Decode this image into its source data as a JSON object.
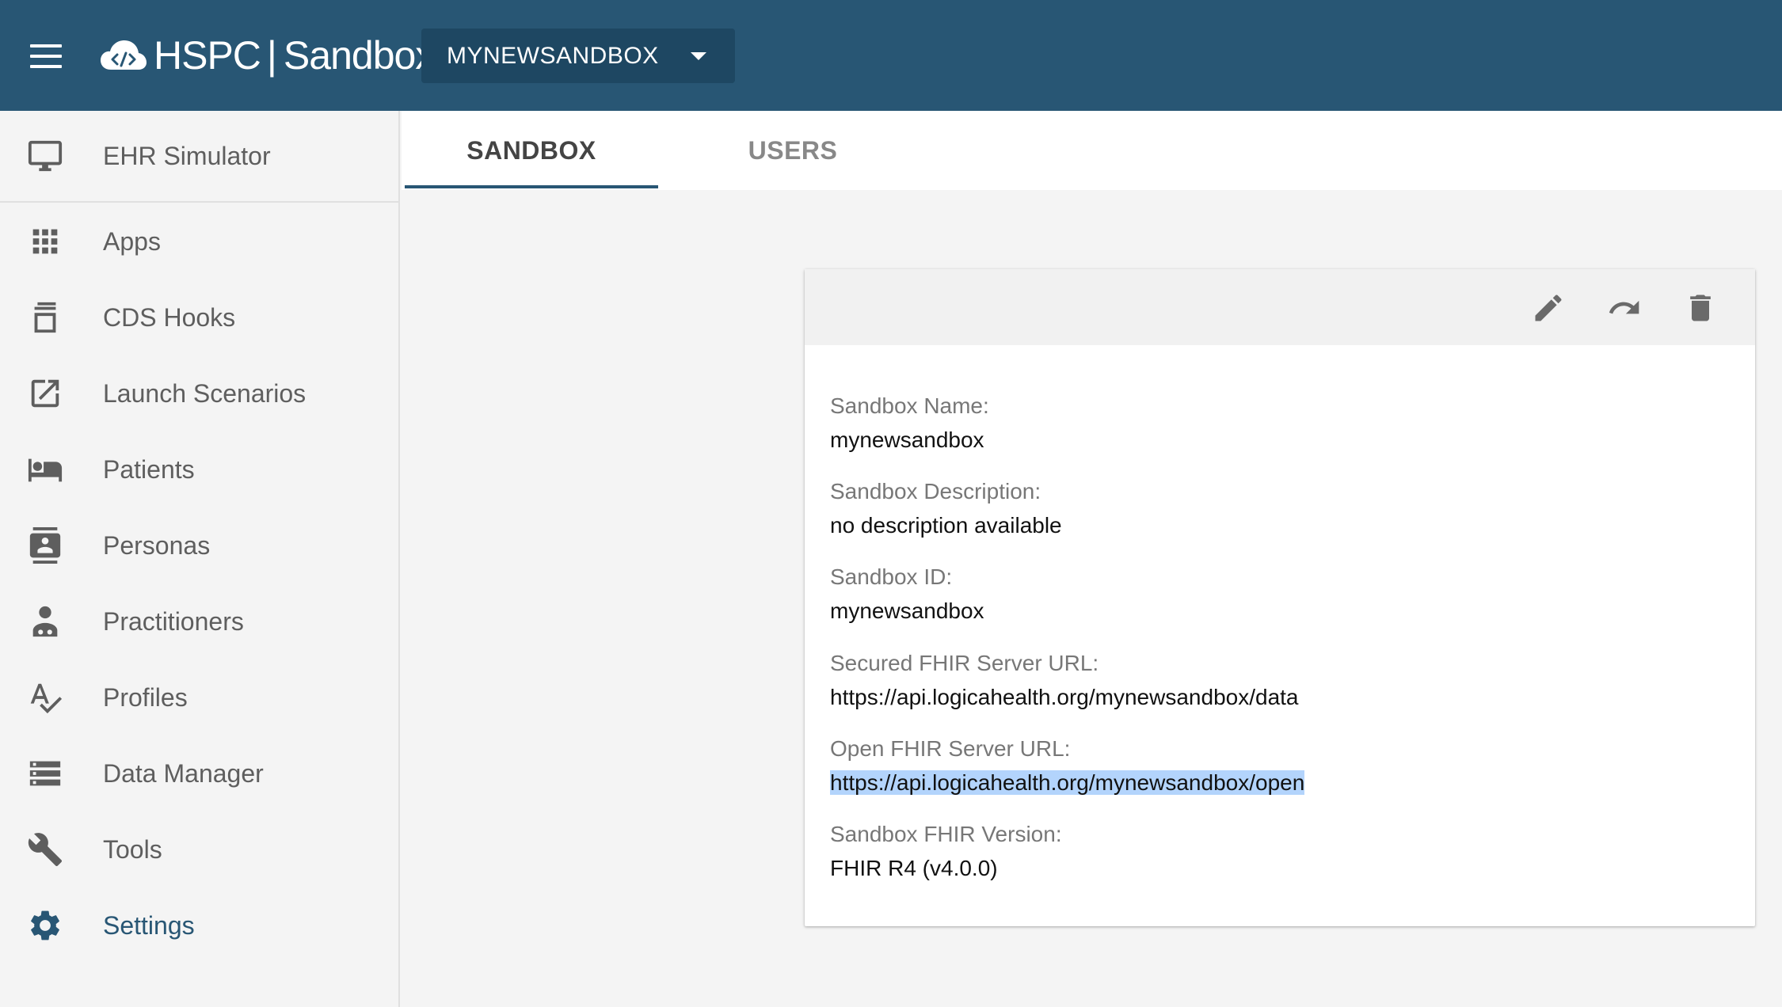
{
  "header": {
    "logo_primary": "HSPC",
    "logo_secondary": "Sandbox",
    "sandbox_selector_label": "MYNEWSANDBOX",
    "background_color": "#285674"
  },
  "sidebar": {
    "items": [
      {
        "label": "EHR Simulator",
        "icon": "monitor-icon"
      },
      {
        "label": "Apps",
        "icon": "apps-grid-icon"
      },
      {
        "label": "CDS Hooks",
        "icon": "cds-hooks-icon"
      },
      {
        "label": "Launch Scenarios",
        "icon": "launch-icon"
      },
      {
        "label": "Patients",
        "icon": "hotel-bed-icon"
      },
      {
        "label": "Personas",
        "icon": "contacts-icon"
      },
      {
        "label": "Practitioners",
        "icon": "practitioner-icon"
      },
      {
        "label": "Profiles",
        "icon": "spellcheck-icon"
      },
      {
        "label": "Data Manager",
        "icon": "storage-icon"
      },
      {
        "label": "Tools",
        "icon": "wrench-icon"
      },
      {
        "label": "Settings",
        "icon": "gear-icon",
        "active": true
      }
    ],
    "active_color": "#285674"
  },
  "tabs": [
    {
      "label": "SANDBOX",
      "active": true
    },
    {
      "label": "USERS",
      "active": false
    }
  ],
  "card": {
    "toolbar_actions": [
      "pencil-icon",
      "redo-icon",
      "trash-icon"
    ],
    "fields": [
      {
        "label": "Sandbox Name:",
        "value": "mynewsandbox"
      },
      {
        "label": "Sandbox Description:",
        "value": "no description available"
      },
      {
        "label": "Sandbox ID:",
        "value": "mynewsandbox"
      },
      {
        "label": "Secured FHIR Server URL:",
        "value": "https://api.logicahealth.org/mynewsandbox/data"
      },
      {
        "label": "Open FHIR Server URL:",
        "value": "https://api.logicahealth.org/mynewsandbox/open",
        "selected": true
      },
      {
        "label": "Sandbox FHIR Version:",
        "value": "FHIR R4 (v4.0.0)"
      }
    ]
  }
}
